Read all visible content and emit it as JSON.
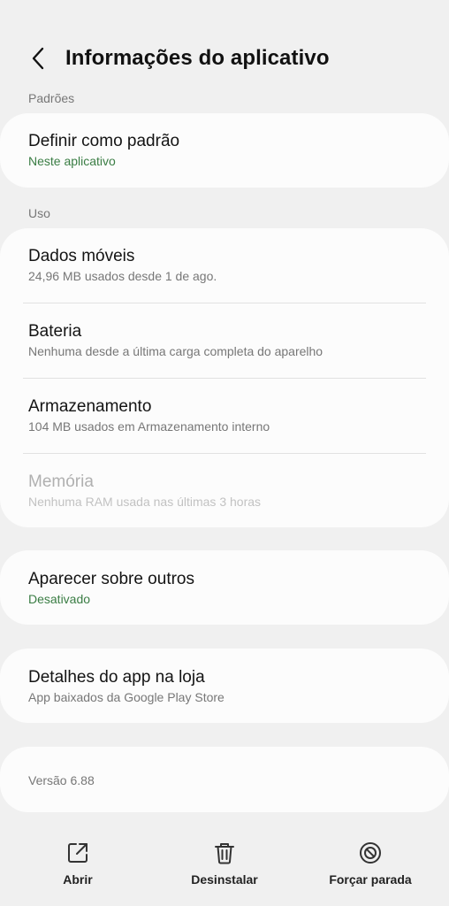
{
  "header": {
    "title": "Informações do aplicativo",
    "back_icon": "chevron-left-icon"
  },
  "sections": {
    "defaults_label": "Padrões",
    "usage_label": "Uso"
  },
  "defaults_card": {
    "title": "Definir como padrão",
    "subtitle": "Neste aplicativo"
  },
  "usage_card": {
    "mobile_data": {
      "title": "Dados móveis",
      "subtitle": "24,96 MB usados desde 1 de ago."
    },
    "battery": {
      "title": "Bateria",
      "subtitle": "Nenhuma desde a última carga completa do aparelho"
    },
    "storage": {
      "title": "Armazenamento",
      "subtitle": "104 MB usados em Armazenamento interno"
    },
    "memory": {
      "title": "Memória",
      "subtitle": "Nenhuma RAM usada nas últimas 3 horas"
    }
  },
  "overlay_card": {
    "title": "Aparecer sobre outros",
    "subtitle": "Desativado"
  },
  "store_card": {
    "title": "Detalhes do app na loja",
    "subtitle": "App baixados da Google Play Store"
  },
  "version_card": {
    "text": "Versão 6.88"
  },
  "bottom_actions": {
    "open_label": "Abrir",
    "uninstall_label": "Desinstalar",
    "force_stop_label": "Forçar parada",
    "open_icon": "open-external-icon",
    "uninstall_icon": "trash-icon",
    "force_stop_icon": "block-icon"
  },
  "colors": {
    "background": "#f0f0f0",
    "card": "#fcfcfc",
    "accent_green": "#3a7d44",
    "secondary_text": "#777777"
  }
}
